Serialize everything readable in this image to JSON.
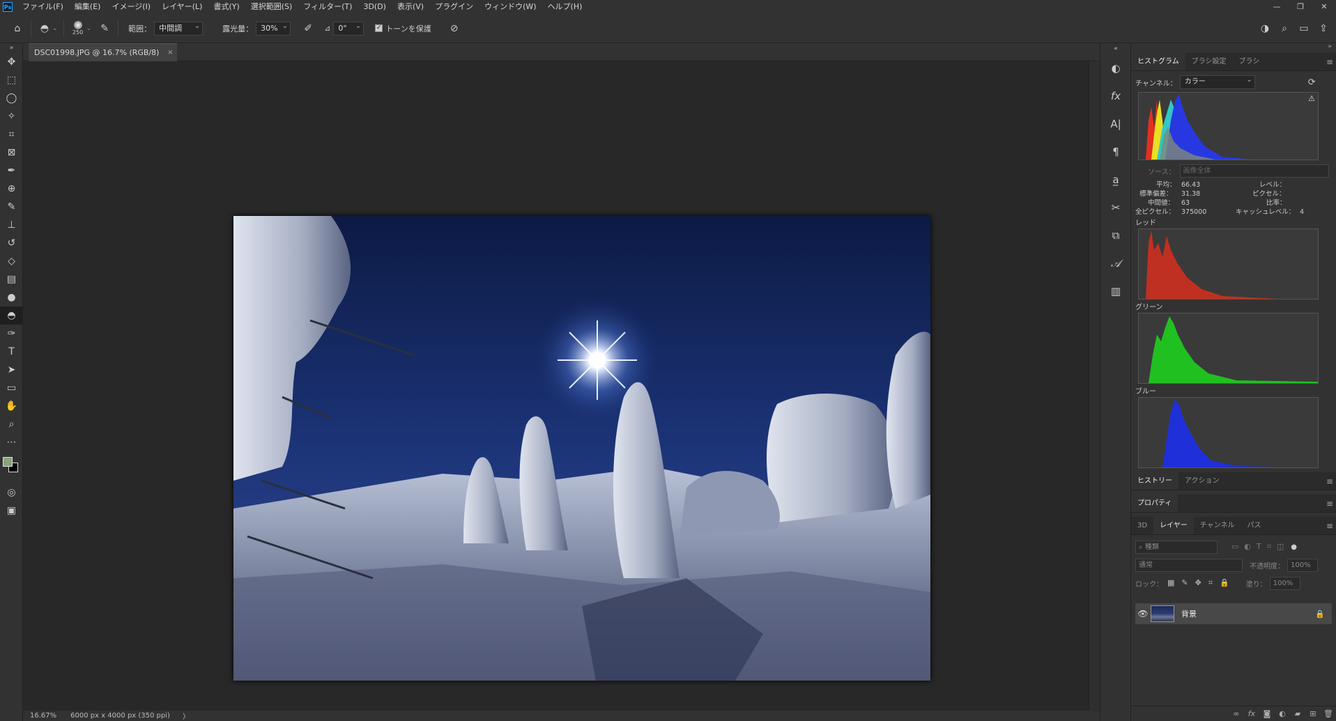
{
  "menubar": {
    "items": [
      "ファイル(F)",
      "編集(E)",
      "イメージ(I)",
      "レイヤー(L)",
      "書式(Y)",
      "選択範囲(S)",
      "フィルター(T)",
      "3D(D)",
      "表示(V)",
      "プラグイン",
      "ウィンドウ(W)",
      "ヘルプ(H)"
    ],
    "window_controls": [
      "—",
      "❐",
      "✕"
    ]
  },
  "options": {
    "brush_size": "250",
    "range_label": "範囲：",
    "range_value": "中間調",
    "exposure_label": "露光量：",
    "exposure_value": "30%",
    "angle_value": "0°",
    "protect_tones_label": "トーンを保護"
  },
  "document": {
    "tab_title": "DSC01998.JPG @ 16.7% (RGB/8)",
    "close": "×"
  },
  "status": {
    "zoom": "16.67%",
    "info": "6000 px x 4000 px (350 ppi)",
    "arrow": "〉"
  },
  "histogram_panel": {
    "tabs": [
      "ヒストグラム",
      "ブラシ設定",
      "ブラシ"
    ],
    "channel_label": "チャンネル：",
    "channel_value": "カラー",
    "source_label": "ソース：",
    "source_value": "画像全体",
    "mean_label": "平均：",
    "mean_value": "66.43",
    "stddev_label": "標準偏差：",
    "stddev_value": "31.38",
    "median_label": "中間値：",
    "median_value": "63",
    "pixels_label": "全ピクセル：",
    "pixels_value": "375000",
    "level_label": "レベル：",
    "count_label": "ピクセル：",
    "percentile_label": "比率：",
    "cache_label": "キャッシュレベル：",
    "cache_value": "4",
    "red_label": "レッド",
    "green_label": "グリーン",
    "blue_label": "ブルー"
  },
  "history_panel": {
    "tabs": [
      "ヒストリー",
      "アクション"
    ]
  },
  "properties_panel": {
    "title": "プロパティ"
  },
  "layers_panel": {
    "tabs": [
      "3D",
      "レイヤー",
      "チャンネル",
      "パス"
    ],
    "search_placeholder": "種類",
    "blend_mode": "通常",
    "opacity_label": "不透明度：",
    "opacity_value": "100%",
    "lock_label": "ロック：",
    "fill_label": "塗り：",
    "fill_value": "100%",
    "layer_name": "背景"
  },
  "colors": {
    "foreground": "#8aa37a",
    "background": "#000000",
    "accent": "#31a8ff"
  }
}
